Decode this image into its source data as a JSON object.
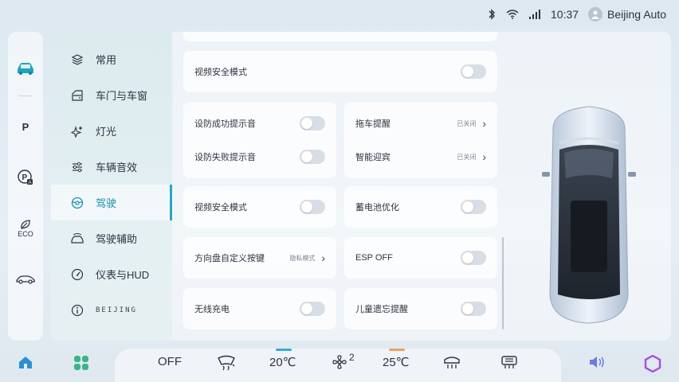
{
  "status_bar": {
    "time": "10:37",
    "user_name": "Beijing Auto",
    "icons": [
      "bluetooth-icon",
      "wifi-icon",
      "signal-icon"
    ]
  },
  "rail": {
    "items": [
      {
        "name": "car-icon"
      },
      {
        "label": "P",
        "name": "parking-assist-icon"
      },
      {
        "name": "auto-park-icon"
      },
      {
        "label": "ECO",
        "name": "eco-icon"
      },
      {
        "name": "drive-mode-icon"
      }
    ]
  },
  "menu": {
    "items": [
      {
        "label": "常用",
        "icon": "layers-icon"
      },
      {
        "label": "车门与车窗",
        "icon": "door-icon"
      },
      {
        "label": "灯光",
        "icon": "sparkle-icon"
      },
      {
        "label": "车辆音效",
        "icon": "equalizer-icon"
      },
      {
        "label": "驾驶",
        "icon": "steering-wheel-icon",
        "active": true
      },
      {
        "label": "驾驶辅助",
        "icon": "assist-car-icon"
      },
      {
        "label": "仪表与HUD",
        "icon": "gauge-icon"
      },
      {
        "label": "BEIJING",
        "icon": "info-icon"
      }
    ]
  },
  "settings": {
    "video_safety_top": "视频安全模式",
    "arm_success_tone": "设防成功提示音",
    "arm_fail_tone": "设防失败提示音",
    "tow_reminder": "拖车提醒",
    "tow_status": "已关闭",
    "smart_welcome": "智能迎宾",
    "welcome_status": "已关闭",
    "video_safety_mid": "视频安全模式",
    "battery_optimize": "蓄电池优化",
    "steering_custom_key": "方向盘自定义按键",
    "steering_key_value": "隐私模式",
    "esp_off": "ESP OFF",
    "wireless_charging": "无线充电",
    "child_reminder": "儿童遗忘提醒"
  },
  "dock": {
    "ac": "OFF",
    "left_temp": "20℃",
    "fan_level": "2",
    "right_temp": "25℃"
  },
  "colors": {
    "accent": "#2aa6c4",
    "left_temp_line": "#3aa9d6",
    "right_temp_line": "#f0a060"
  }
}
